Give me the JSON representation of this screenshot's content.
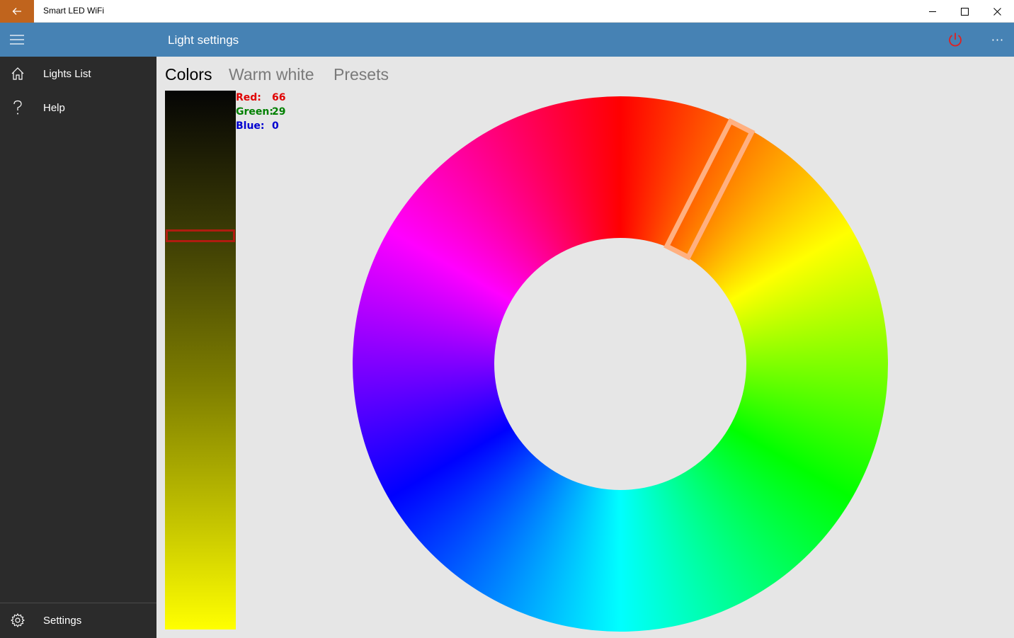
{
  "window": {
    "title": "Smart LED WiFi",
    "controls": [
      "minimize-icon",
      "maximize-icon",
      "close-icon"
    ]
  },
  "header": {
    "title": "Light settings",
    "power_color": "#e02020",
    "more_label": "···"
  },
  "sidebar": {
    "items": [
      {
        "label": "Lights List",
        "icon": "home-icon"
      },
      {
        "label": "Help",
        "icon": "question-icon"
      }
    ],
    "footer": {
      "label": "Settings",
      "icon": "gear-icon"
    }
  },
  "tabs": [
    {
      "label": "Colors",
      "active": true
    },
    {
      "label": "Warm white",
      "active": false
    },
    {
      "label": "Presets",
      "active": false
    }
  ],
  "rgb": {
    "red_label": "Red:",
    "red_value": "66",
    "green_label": "Green:",
    "green_value": "29",
    "blue_label": "Blue:",
    "blue_value": "0"
  },
  "brightness": {
    "level": 0.27
  },
  "hue_selector": {
    "hue_degrees": 27
  },
  "colors": {
    "accent_header": "#4682b4",
    "back_button": "#c0641d",
    "sidebar_bg": "#2b2b2b",
    "red_text": "#e00000",
    "green_text": "#008000",
    "blue_text": "#0000d0",
    "brightness_thumb": "#b01c10",
    "hue_marker": "#ffb080"
  }
}
